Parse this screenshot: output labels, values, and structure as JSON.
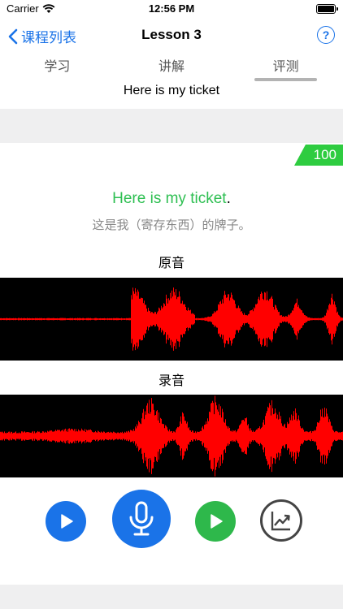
{
  "status": {
    "carrier": "Carrier",
    "time": "12:56 PM"
  },
  "nav": {
    "back_label": "课程列表",
    "title": "Lesson 3",
    "help_label": "?"
  },
  "tabs": [
    {
      "label": "学习"
    },
    {
      "label": "讲解"
    },
    {
      "label": "评测",
      "active": true
    }
  ],
  "sentence_strip": "Here is my ticket",
  "evaluation": {
    "score": "100",
    "sentence_matched": "Here is my ticket",
    "sentence_punct": ".",
    "translation": "这是我（寄存东西）的牌子。",
    "original_label": "原音",
    "recording_label": "录音"
  },
  "colors": {
    "accent": "#1a73e8",
    "success": "#2ebf52",
    "waveform": "#ff0000",
    "wave_bg": "#000000"
  },
  "icons": {
    "back": "chevron-left-icon",
    "help": "question-circle-icon",
    "play": "play-icon",
    "record": "microphone-icon",
    "playback": "play-icon",
    "chart": "trend-chart-icon"
  }
}
